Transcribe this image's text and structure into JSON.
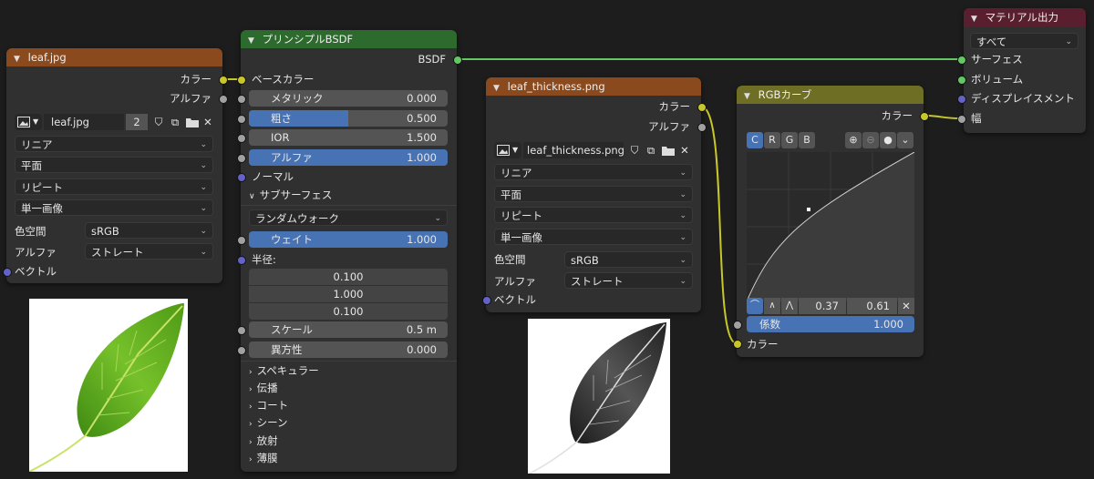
{
  "nodes": {
    "leaf_image": {
      "title": "leaf.jpg",
      "header_color": "#8a4a1e",
      "outputs": [
        "カラー",
        "アルファ"
      ],
      "image_name": "leaf.jpg",
      "users": "2",
      "interpolation": "リニア",
      "projection": "平面",
      "extension": "リピート",
      "source": "単一画像",
      "colorspace_label": "色空間",
      "colorspace_value": "sRGB",
      "alpha_label": "アルファ",
      "alpha_value": "ストレート",
      "input": "ベクトル"
    },
    "bsdf": {
      "title": "プリンシプルBSDF",
      "header_color": "#2d6a2d",
      "output": "BSDF",
      "base_color": "ベースカラー",
      "metallic_label": "メタリック",
      "metallic_value": "0.000",
      "roughness_label": "粗さ",
      "roughness_value": "0.500",
      "roughness_fraction": 0.5,
      "ior_label": "IOR",
      "ior_value": "1.500",
      "alpha_label": "アルファ",
      "alpha_value": "1.000",
      "normal": "ノーマル",
      "subsurface": "サブサーフェス",
      "subsurface_method": "ランダムウォーク",
      "weight_label": "ウェイト",
      "weight_value": "1.000",
      "radius_label": "半径:",
      "radius_values": [
        "0.100",
        "1.000",
        "0.100"
      ],
      "scale_label": "スケール",
      "scale_value": "0.5 m",
      "anisotropy_label": "異方性",
      "anisotropy_value": "0.000",
      "panels": [
        "スペキュラー",
        "伝播",
        "コート",
        "シーン",
        "放射",
        "薄膜"
      ]
    },
    "thickness_image": {
      "title": "leaf_thickness.png",
      "header_color": "#8a4a1e",
      "outputs": [
        "カラー",
        "アルファ"
      ],
      "image_name": "leaf_thickness.png",
      "interpolation": "リニア",
      "projection": "平面",
      "extension": "リピート",
      "source": "単一画像",
      "colorspace_label": "色空間",
      "colorspace_value": "sRGB",
      "alpha_label": "アルファ",
      "alpha_value": "ストレート",
      "input": "ベクトル"
    },
    "rgb_curve": {
      "title": "RGBカーブ",
      "header_color": "#6e6e24",
      "output": "カラー",
      "channels": [
        "C",
        "R",
        "G",
        "B"
      ],
      "point_x": "0.37",
      "point_y": "0.61",
      "factor_label": "係数",
      "factor_value": "1.000",
      "color_input": "カラー"
    },
    "material_output": {
      "title": "マテリアル出力",
      "header_color": "#5a1f2e",
      "target": "すべて",
      "inputs": [
        "サーフェス",
        "ボリューム",
        "ディスプレイスメント",
        "幅"
      ]
    }
  },
  "colors": {
    "editor_bg": "#1d1d1d",
    "node_bg": "#303030",
    "slider_fill": "#4772b3",
    "socket_color": "#c7c729",
    "socket_shader": "#63c763",
    "socket_float": "#a1a1a1",
    "socket_vector": "#6363c7"
  },
  "icons": [
    "image-icon",
    "shield-icon",
    "duplicate-icon",
    "folder-icon",
    "close-icon",
    "chevron-down-icon",
    "chevron-right-icon",
    "zoom-in-icon",
    "zoom-out-icon",
    "dot-icon",
    "handle-auto-icon",
    "handle-vector-icon",
    "handle-free-icon"
  ]
}
